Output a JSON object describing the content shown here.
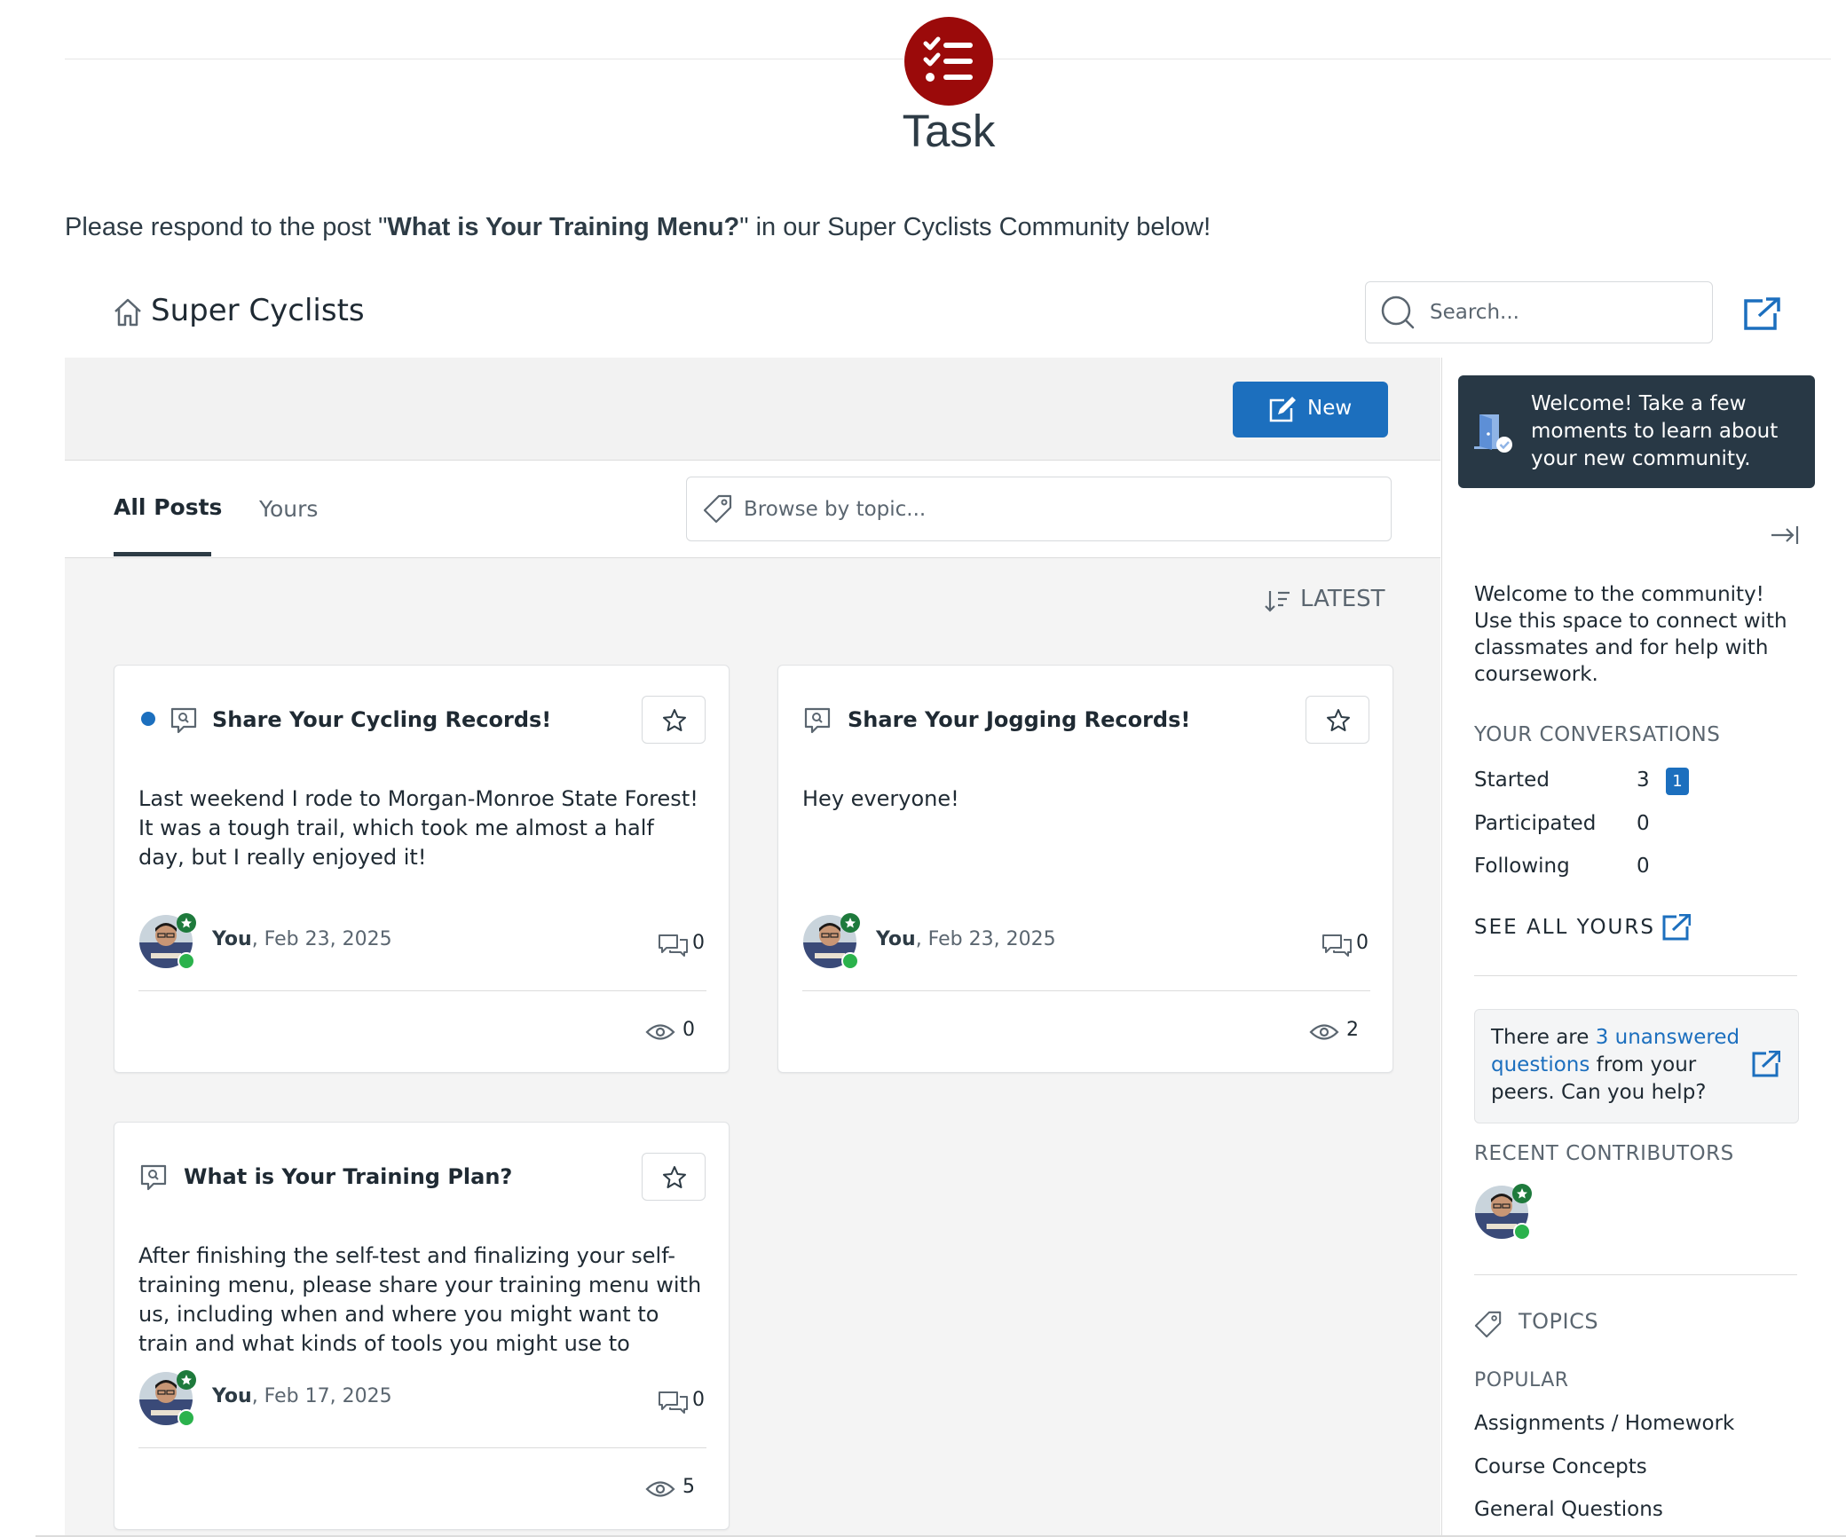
{
  "task": {
    "title": "Task",
    "instructions_pre": "Please respond to the post \"",
    "instructions_bold": "What is Your Training Menu?",
    "instructions_post": "\" in our Super Cyclists Community below!"
  },
  "community": {
    "title": "Super Cyclists",
    "search_placeholder": "Search...",
    "new_button_label": "New",
    "tabs": [
      {
        "label": "All Posts",
        "active": true
      },
      {
        "label": "Yours",
        "active": false
      }
    ],
    "topic_placeholder": "Browse by topic...",
    "sort_label": "LATEST"
  },
  "posts": [
    {
      "title": "Share Your Cycling Records!",
      "unread": true,
      "body": "Last weekend I rode to Morgan-Monroe State Forest! It was a tough trail, which took me almost a half day, but I really enjoyed it!",
      "author": "You",
      "date": ", Feb 23, 2025",
      "replies": "0",
      "views": "0"
    },
    {
      "title": "Share Your Jogging Records!",
      "unread": false,
      "body": "Hey everyone!",
      "author": "You",
      "date": ", Feb 23, 2025",
      "replies": "0",
      "views": "2"
    },
    {
      "title": "What is Your Training Plan?",
      "unread": false,
      "body": "After finishing the self-test and finalizing your self-training menu, please share your training menu with us, including when and where you might want to train and what kinds of tools you might use to support your",
      "author": "You",
      "date": ", Feb 17, 2025",
      "replies": "0",
      "views": "5"
    }
  ],
  "sidebar": {
    "welcome_text": "Welcome! Take a few moments to learn about your new community.",
    "intro": "Welcome to the community! Use this space to connect with classmates and for help with coursework.",
    "conversations_heading": "YOUR CONVERSATIONS",
    "conversations": [
      {
        "label": "Started",
        "count": "3",
        "badge": "1"
      },
      {
        "label": "Participated",
        "count": "0"
      },
      {
        "label": "Following",
        "count": "0"
      }
    ],
    "see_all_label": "SEE ALL YOURS",
    "unanswered_pre": "There are ",
    "unanswered_link": "3 unanswered questions",
    "unanswered_post": " from your peers. Can you help?",
    "recent_contributors_heading": "RECENT CONTRIBUTORS",
    "topics_heading": "TOPICS",
    "popular_heading": "POPULAR",
    "topics": [
      "Assignments / Homework",
      "Course Concepts",
      "General Questions"
    ]
  },
  "colors": {
    "task_icon_bg": "#9b0a0a",
    "primary": "#1c6fbe",
    "welcome_bg": "#283845",
    "online": "#2bb24c",
    "badge_green": "#1e7a3c"
  }
}
